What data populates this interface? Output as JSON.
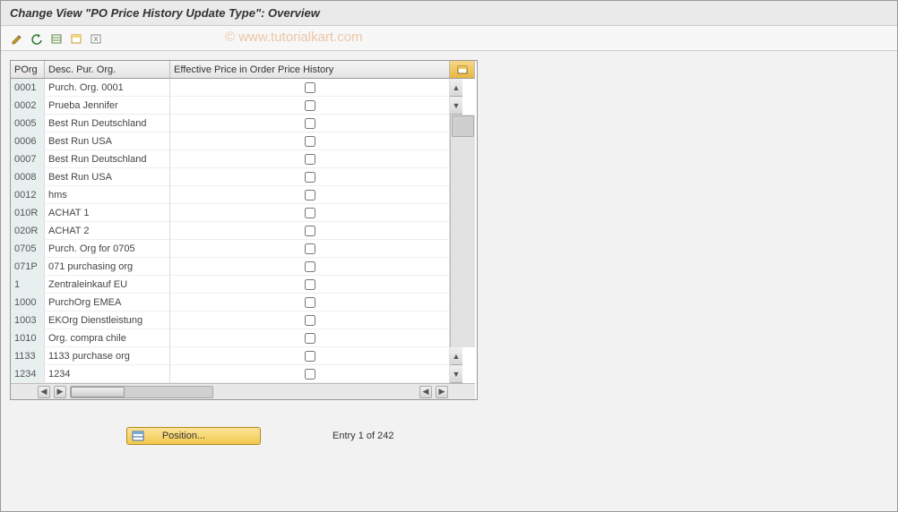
{
  "title": "Change View \"PO Price History Update Type\": Overview",
  "watermark": "© www.tutorialkart.com",
  "toolbar": {
    "icons": [
      "change-icon",
      "undo-icon",
      "select-all-icon",
      "select-block-icon",
      "deselect-icon"
    ]
  },
  "table": {
    "headers": {
      "porg": "POrg",
      "desc": "Desc. Pur. Org.",
      "effective": "Effective Price in Order Price History"
    },
    "rows": [
      {
        "porg": "0001",
        "desc": "Purch. Org. 0001",
        "eff": false
      },
      {
        "porg": "0002",
        "desc": "Prueba Jennifer",
        "eff": false
      },
      {
        "porg": "0005",
        "desc": "Best Run Deutschland",
        "eff": false
      },
      {
        "porg": "0006",
        "desc": "Best Run USA",
        "eff": false
      },
      {
        "porg": "0007",
        "desc": "Best Run Deutschland",
        "eff": false
      },
      {
        "porg": "0008",
        "desc": "Best Run USA",
        "eff": false
      },
      {
        "porg": "0012",
        "desc": "hms",
        "eff": false
      },
      {
        "porg": "010R",
        "desc": "ACHAT 1",
        "eff": false
      },
      {
        "porg": "020R",
        "desc": "ACHAT 2",
        "eff": false
      },
      {
        "porg": "0705",
        "desc": "Purch. Org for 0705",
        "eff": false
      },
      {
        "porg": "071P",
        "desc": "071 purchasing org",
        "eff": false
      },
      {
        "porg": "1",
        "desc": "Zentraleinkauf EU",
        "eff": false
      },
      {
        "porg": "1000",
        "desc": "PurchOrg EMEA",
        "eff": false
      },
      {
        "porg": "1003",
        "desc": "EKOrg Dienstleistung",
        "eff": false
      },
      {
        "porg": "1010",
        "desc": "Org. compra chile",
        "eff": false
      },
      {
        "porg": "1133",
        "desc": "1133 purchase org",
        "eff": false
      },
      {
        "porg": "1234",
        "desc": "1234",
        "eff": false
      }
    ]
  },
  "footer": {
    "position_label": "Position...",
    "entry_text": "Entry 1 of 242"
  }
}
